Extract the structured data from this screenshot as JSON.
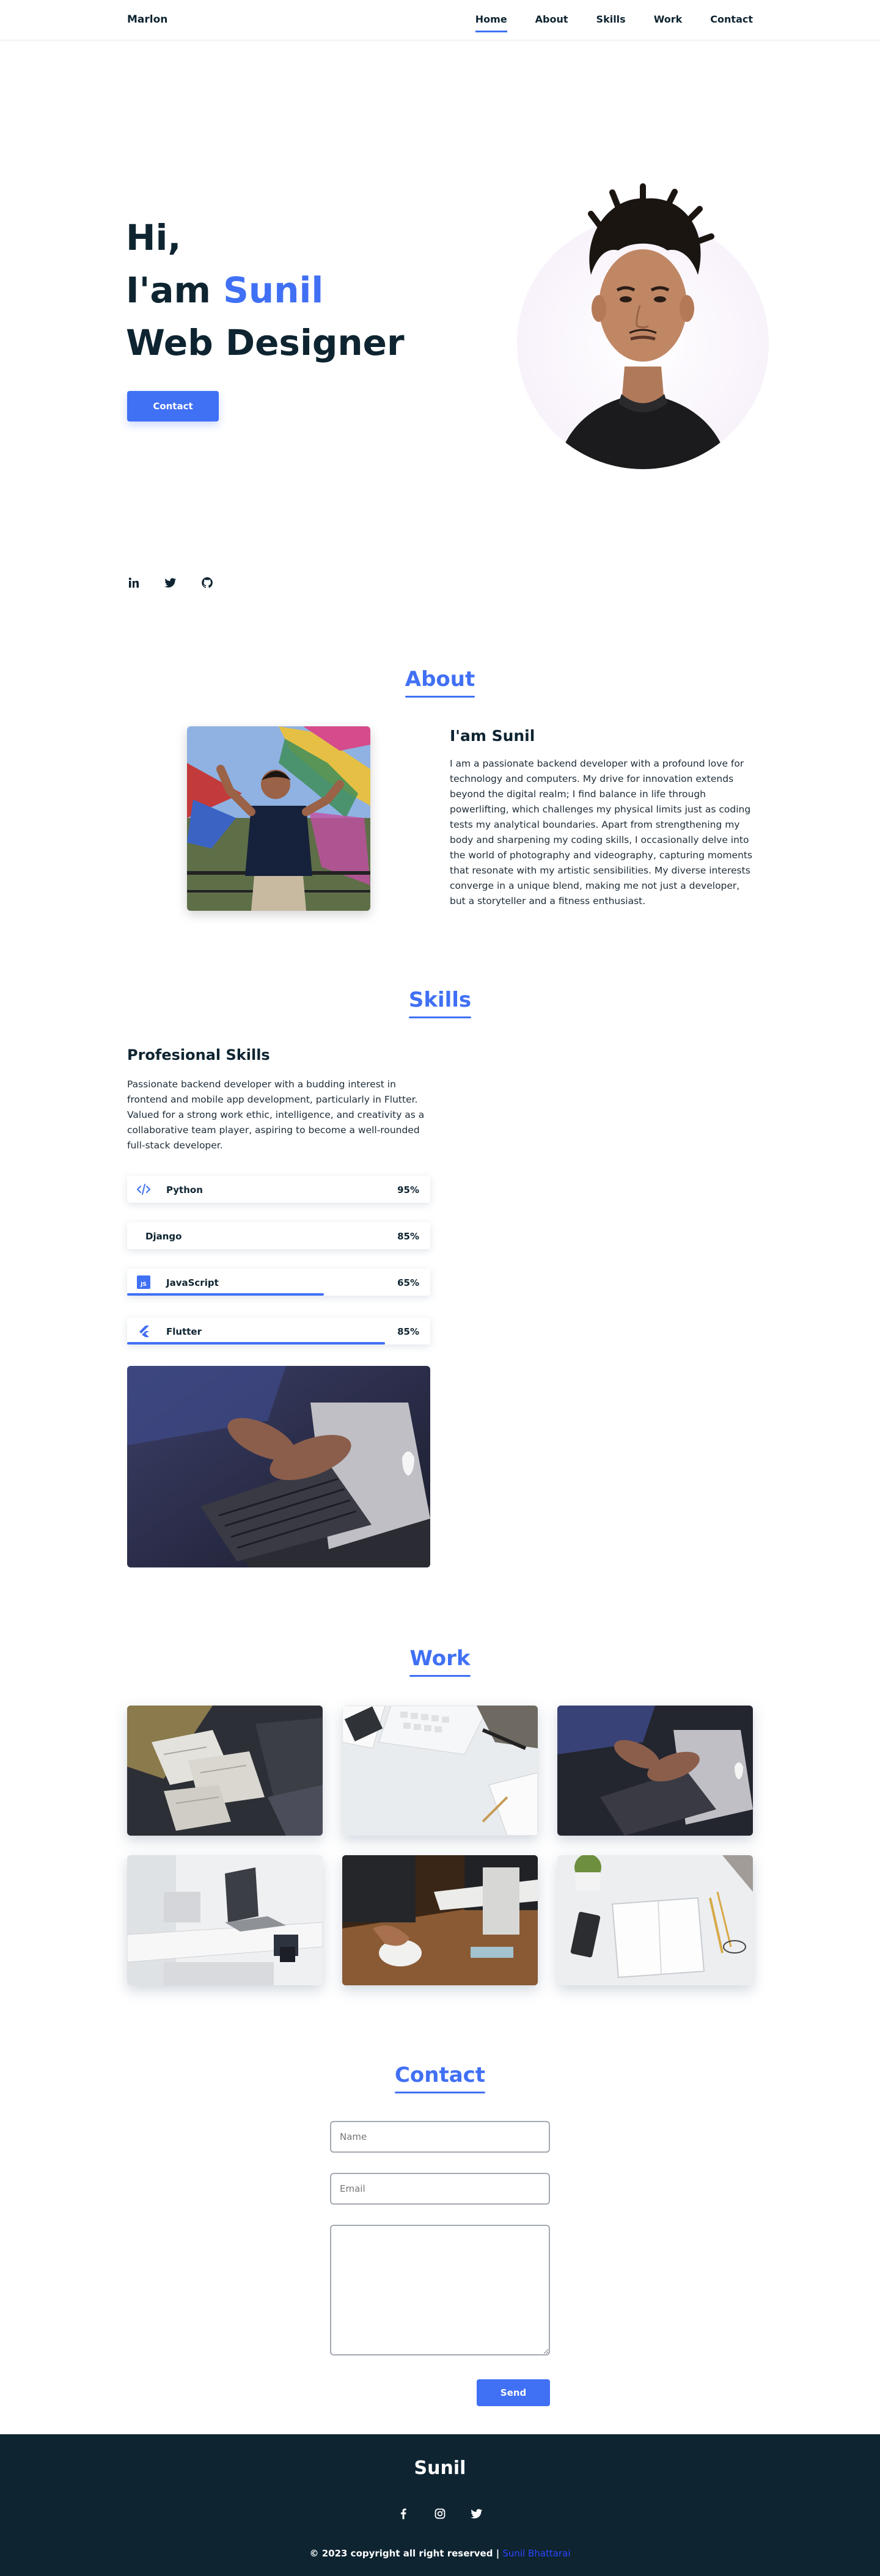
{
  "header": {
    "logo": "Marlon",
    "nav": [
      {
        "label": "Home",
        "active": true
      },
      {
        "label": "About"
      },
      {
        "label": "Skills"
      },
      {
        "label": "Work"
      },
      {
        "label": "Contact"
      }
    ]
  },
  "hero": {
    "line1": "Hi,",
    "line2_prefix": "I'am",
    "line2_name": "Sunil",
    "line3": "Web Designer",
    "button_label": "Contact",
    "socials": [
      "linkedin-icon",
      "twitter-icon",
      "github-icon"
    ]
  },
  "about": {
    "title": "About",
    "heading": "I'am Sunil",
    "text": "I am a passionate backend developer with a profound love for technology and computers. My drive for innovation extends beyond the digital realm; I find balance in life through powerlifting, which challenges my physical limits just as coding tests my analytical boundaries. Apart from strengthening my body and sharpening my coding skills, I occasionally delve into the world of photography and videography, capturing moments that resonate with my artistic sensibilities. My diverse interests converge in a unique blend, making me not just a developer, but a storyteller and a fitness enthusiast."
  },
  "skills": {
    "title": "Skills",
    "heading": "Profesional Skills",
    "text": "Passionate backend developer with a budding interest in frontend and mobile app development, particularly in Flutter. Valued for a strong work ethic, intelligence, and creativity as a collaborative team player, aspiring to become a well-rounded full-stack developer.",
    "items": [
      {
        "name": "Python",
        "percent": "95%",
        "icon": "code-icon",
        "bar": 0
      },
      {
        "name": "Django",
        "percent": "85%",
        "icon": "",
        "bar": 0
      },
      {
        "name": "JavaScript",
        "percent": "65%",
        "icon": "javascript-icon",
        "bar": 0.65
      },
      {
        "name": "Flutter",
        "percent": "85%",
        "icon": "flutter-icon",
        "bar": 0.85
      }
    ]
  },
  "work": {
    "title": "Work"
  },
  "contact": {
    "title": "Contact",
    "name_placeholder": "Name",
    "email_placeholder": "Email",
    "message_placeholder": "",
    "send_label": "Send"
  },
  "footer": {
    "name": "Sunil",
    "icons": [
      "facebook-icon",
      "instagram-icon",
      "twitter-icon"
    ],
    "copyright": "© 2023 copyright all right reserved |",
    "link": "Sunil Bhattarai"
  },
  "colors": {
    "accent": "#4070f4",
    "dark": "#0e2431"
  }
}
